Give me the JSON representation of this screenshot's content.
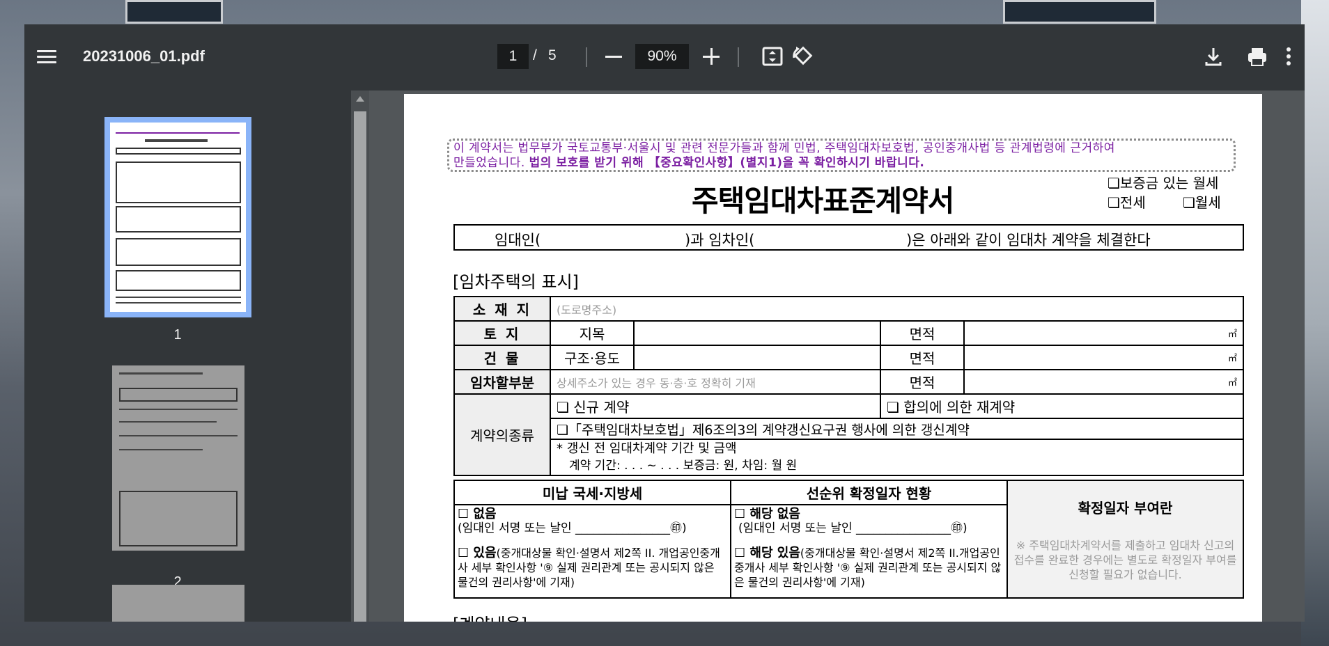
{
  "toolbar": {
    "file_name": "20231006_01.pdf",
    "current_page": "1",
    "page_separator": "/",
    "total_pages": "5",
    "zoom": "90%",
    "icons": [
      "menu-icon",
      "zoom-out-icon",
      "zoom-in-icon",
      "fit-page-icon",
      "rotate-icon",
      "download-icon",
      "print-icon",
      "more-icon"
    ]
  },
  "sidebar": {
    "thumbnails": [
      {
        "label": "1"
      },
      {
        "label": "2"
      }
    ]
  },
  "document": {
    "notice_line1": "이 계약서는 법무부가 국토교통부·서울시 및 관련 전문가들과 함께 민법, 주택임대차보호법, 공인중개사법 등 관계법령에 근거하여",
    "notice_line2_plain": "만들었습니다. ",
    "notice_line2_bold": "법의 보호를 받기 위해 【중요확인사항】(별지1)을 꼭 확인하시기 바랍니다.",
    "title": "주택임대차표준계약서",
    "check_deposit_monthly": "❏보증금 있는 월세",
    "check_jeonse": "❏전세",
    "check_monthly": "❏월세",
    "party_lessor": "임대인(",
    "party_mid": ")과 임차인(",
    "party_end": ")은 아래와 같이 임대차 계약을 체결한다",
    "section_property": "[임차주택의 표시]",
    "rows": {
      "location_label": "소 재 지",
      "location_hint": "(도로명주소)",
      "land_label": "토    지",
      "land_sub": "지목",
      "area_label": "면적",
      "m2": "㎡",
      "building_label": "건    물",
      "building_sub": "구조·용도",
      "rent_part_label": "임차할부분",
      "rent_part_hint": "상세주소가 있는 경우 동·층·호 정확히 기재",
      "contract_type_label": "계약의종류",
      "new_contract": "❏ 신규 계약",
      "agreed_renewal": "❏ 합의에 의한 재계약",
      "renewal_right": "❏「주택임대차보호법」제6조의3의 계약갱신요구권 행사에 의한 갱신계약",
      "prev_contract": "* 갱신 전 임대차계약 기간 및 금액",
      "prev_period": "계약 기간:      .     .     . ~      .     .     .    보증금:                         원,  차임: 월                    원"
    },
    "tax": {
      "unpaid_header": "미납 국세·지방세",
      "priority_header": "선순위 확정일자 현황",
      "none": "☐ 없음",
      "lessor_sign": "(임대인 서명 또는 날인 ________________㊞)",
      "exists_bold": "☐ 있음",
      "exists_text": "(중개대상물 확인·설명서 제2쪽 II. 개업공인중개사 세부 확인사항 '⑨ 실제 권리관계 또는 공시되지 않은 물건의 권리사항'에 기재)",
      "not_applicable": "☐ 해당 없음",
      "lessor_sign2": "(임대인 서명 또는 날인 ________________㊞)",
      "applicable_bold": "☐ 해당 있음",
      "applicable_text": "(중개대상물 확인·설명서 제2쪽 II.개업공인중개사 세부 확인사항 '⑨ 실제 권리관계 또는 공시되지 않은 물건의 권리사항'에 기재)",
      "fixed_date_header": "확정일자 부여란",
      "fixed_date_note": "※ 주택임대차계약서를 제출하고 임대차 신고의 접수를 완료한 경우에는 별도로 확정일자 부여를 신청할 필요가 없습니다."
    },
    "section_contract": "[계약내용]"
  }
}
